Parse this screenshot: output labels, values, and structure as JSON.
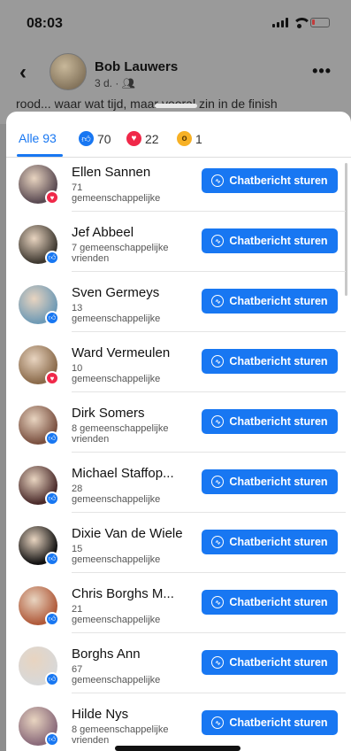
{
  "status_bar": {
    "time": "08:03"
  },
  "post": {
    "author": "Bob Lauwers",
    "meta": "3 d. · ",
    "text_fragment": "rood... waar wat tijd, maar vooral zin in de finish"
  },
  "tabs": [
    {
      "label": "Alle 93",
      "active": true
    },
    {
      "icon": "like-icon",
      "count": "70"
    },
    {
      "icon": "heart-icon",
      "count": "22"
    },
    {
      "icon": "wow-icon",
      "count": "1"
    }
  ],
  "button_label": "Chatbericht sturen",
  "people": [
    {
      "name": "Ellen Sannen",
      "sub": "71\ngemeenschappelijke",
      "reaction": "heart",
      "avatar_color": "#5a4a52"
    },
    {
      "name": "Jef Abbeel",
      "sub": "7 gemeenschappelijke\nvrienden",
      "reaction": "like",
      "avatar_color": "#3e3830"
    },
    {
      "name": "Sven Germeys",
      "sub": "13\ngemeenschappelijke",
      "reaction": "like",
      "avatar_color": "#6f9ab5"
    },
    {
      "name": "Ward Vermeulen",
      "sub": "10\ngemeenschappelijke",
      "reaction": "heart",
      "avatar_color": "#8a6a4a"
    },
    {
      "name": "Dirk Somers",
      "sub": "8 gemeenschappelijke\nvrienden",
      "reaction": "like",
      "avatar_color": "#7a5040"
    },
    {
      "name": "Michael Staffop...",
      "sub": "28\ngemeenschappelijke",
      "reaction": "like",
      "avatar_color": "#4a2a2a"
    },
    {
      "name": "Dixie Van de Wiele",
      "sub": "15\ngemeenschappelijke",
      "reaction": "like",
      "avatar_color": "#111111"
    },
    {
      "name": "Chris Borghs M...",
      "sub": "21\ngemeenschappelijke",
      "reaction": "like",
      "avatar_color": "#b05a3a"
    },
    {
      "name": "Borghs Ann",
      "sub": "67\ngemeenschappelijke",
      "reaction": "like",
      "avatar_color": "#d8d8d8"
    },
    {
      "name": "Hilde Nys",
      "sub": "8 gemeenschappelijke\nvrienden",
      "reaction": "like",
      "avatar_color": "#8a6a7a"
    }
  ]
}
